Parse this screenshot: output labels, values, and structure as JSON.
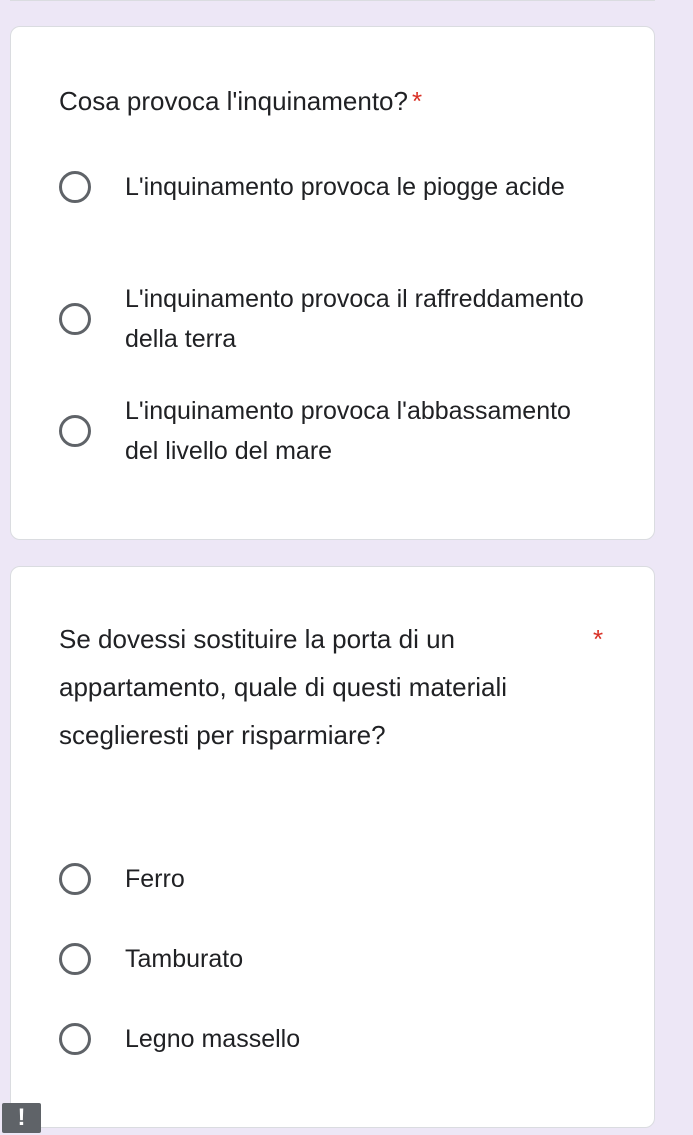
{
  "questions": [
    {
      "title": "Cosa provoca l'inquinamento?",
      "required_mark": "*",
      "options": [
        {
          "label": "L'inquinamento provoca le piogge acide",
          "selected": false
        },
        {
          "label": "L'inquinamento provoca il raffreddamento della terra",
          "selected": false
        },
        {
          "label": "L'inquinamento provoca l'abbassamento del livello del mare",
          "selected": false
        }
      ]
    },
    {
      "title": "Se dovessi sostituire la porta di un appartamento, quale di questi materiali sceglieresti per risparmiare?",
      "required_mark": "*",
      "options": [
        {
          "label": "Ferro",
          "selected": false
        },
        {
          "label": "Tamburato",
          "selected": false
        },
        {
          "label": "Legno massello",
          "selected": false
        }
      ]
    }
  ],
  "overlay_badge": {
    "label": "!"
  },
  "colors": {
    "background": "#ede7f6",
    "card": "#ffffff",
    "required": "#d93025",
    "radio_border": "#5f6368",
    "text": "#202124"
  }
}
